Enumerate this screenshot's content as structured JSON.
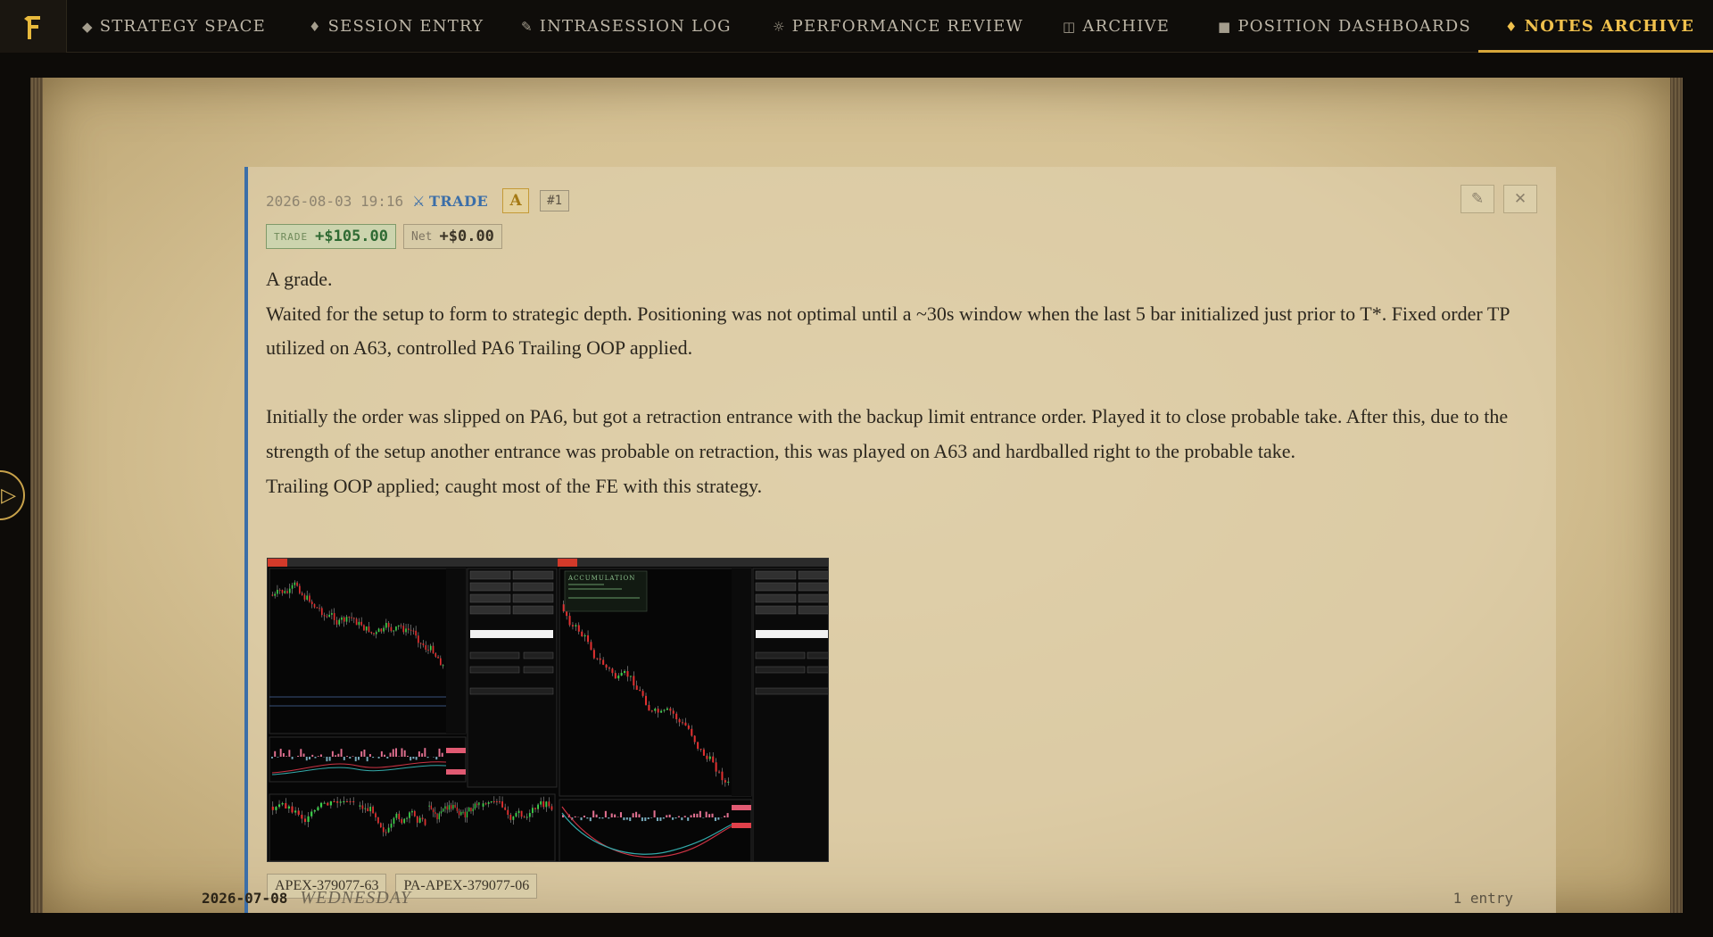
{
  "nav": {
    "logo_icon": "forge-f-icon",
    "items": [
      {
        "icon": "◆",
        "label": "STRATEGY SPACE"
      },
      {
        "icon": "♦",
        "label": "SESSION ENTRY"
      },
      {
        "icon": "✎",
        "label": "INTRASESSION LOG"
      },
      {
        "icon": "☼",
        "label": "PERFORMANCE REVIEW"
      },
      {
        "icon": "◫",
        "label": "ARCHIVE"
      },
      {
        "icon": "■",
        "label": "POSITION DASHBOARDS"
      },
      {
        "icon": "♦",
        "label": "NOTES ARCHIVE"
      }
    ],
    "active": "NOTES ARCHIVE"
  },
  "sidebar_toggle": {
    "icon": "▷"
  },
  "entry": {
    "timestamp": "2026-08-03 19:16",
    "type_icon": "⚔",
    "type": "TRADE",
    "grade": "A",
    "number": "#1",
    "edit_icon": "✎",
    "close_icon": "✕",
    "trade_pnl": {
      "label": "TRADE",
      "value": "+$105.00"
    },
    "net_pnl": {
      "label": "Net",
      "value": "+$0.00"
    },
    "body": [
      "A grade.",
      "Waited for the setup to form to strategic depth. Positioning was not optimal until a ~30s window when the last 5 bar initialized just prior to T*. Fixed order  TP utilized on A63, controlled PA6 Trailing OOP applied.",
      "",
      "Initially the order was slipped on PA6, but got a retraction entrance with the backup limit entrance order. Played it to close probable take. After this, due to the strength of the setup another entrance was probable on retraction, this was played on A63 and hardballed right to the probable take.",
      "Trailing OOP applied; caught most of the FE with this strategy."
    ],
    "screenshot_caption": "ACCUMULATION",
    "accounts": [
      "APEX-379077-63",
      "PA-APEX-379077-06"
    ]
  },
  "day_divider": {
    "date": "2026-07-08",
    "weekday": "WEDNESDAY",
    "count": "1 entry"
  },
  "colors": {
    "accent_gold": "#f0c14d",
    "trade_blue": "#3b6ea8",
    "profit_green": "#2f6a33",
    "parchment": "#d5c194"
  }
}
